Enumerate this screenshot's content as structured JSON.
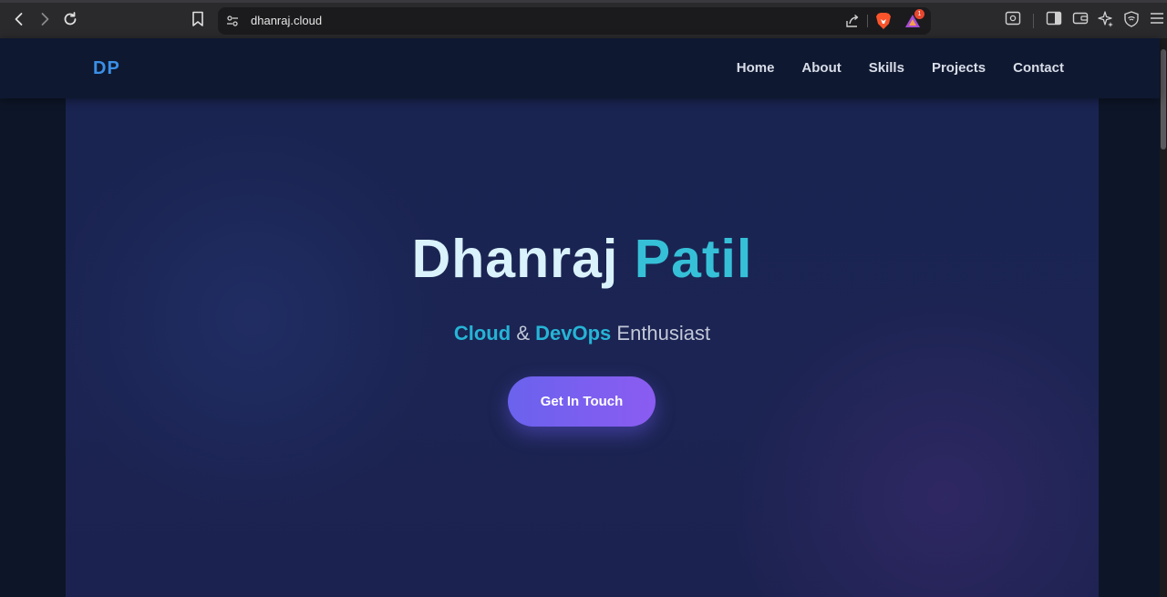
{
  "browser": {
    "url": "dhanraj.cloud",
    "rewards_badge_count": "1",
    "icons": {
      "back": "back-arrow-icon",
      "forward": "forward-arrow-icon",
      "reload": "reload-icon",
      "bookmark": "bookmark-icon",
      "site_settings": "site-settings-icon",
      "share": "share-icon",
      "brave_shields": "brave-lion-icon",
      "rewards": "brave-rewards-icon",
      "screenshot": "screenshot-icon",
      "sidebar": "sidebar-toggle-icon",
      "wallet": "wallet-icon",
      "leo": "leo-ai-icon",
      "vpn": "vpn-shield-icon",
      "menu": "hamburger-menu-icon"
    }
  },
  "site": {
    "logo": "DP",
    "nav": [
      "Home",
      "About",
      "Skills",
      "Projects",
      "Contact"
    ],
    "hero": {
      "first_name": "Dhanraj",
      "last_name": "Patil",
      "sub_word_1": "Cloud",
      "sub_amp": "&",
      "sub_word_2": "DevOps",
      "sub_rest": "Enthusiast",
      "cta_label": "Get In Touch"
    }
  },
  "colors": {
    "logo": "#3b8fe6",
    "name_first": "#d9f2fb",
    "name_last": "#35c0d8",
    "accent": "#26b4d6",
    "cta_start": "#6a62ee",
    "cta_end": "#8b5cf1"
  }
}
